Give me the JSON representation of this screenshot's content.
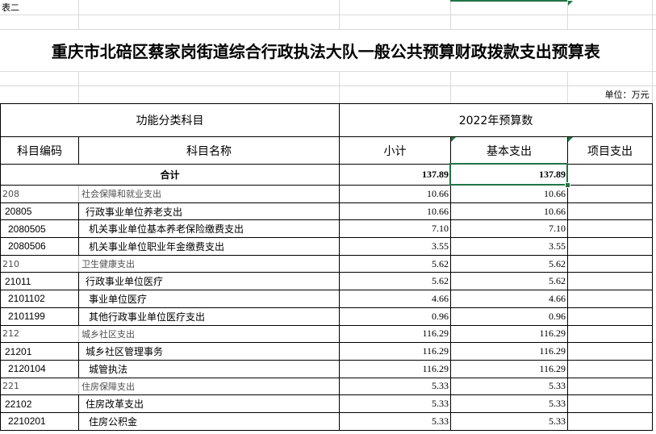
{
  "sheet": {
    "label": "表二",
    "title": "重庆市北碚区蔡家岗街道综合行政执法大队一般公共预算财政拨款支出预算表",
    "unit": "单位：万元"
  },
  "table": {
    "header_groups": {
      "functional_category": "功能分类科目",
      "budget_year": "2022年预算数"
    },
    "columns": {
      "code": "科目编码",
      "name": "科目名称",
      "subtotal": "小计",
      "basic": "基本支出",
      "project": "项目支出"
    },
    "total": {
      "label": "合计",
      "subtotal": "137.89",
      "basic": "137.89",
      "project": ""
    },
    "rows": [
      {
        "code": "208",
        "name": "社会保障和就业支出",
        "subtotal": "10.66",
        "basic": "10.66",
        "project": ""
      },
      {
        "code": "20805",
        "name": "行政事业单位养老支出",
        "subtotal": "10.66",
        "basic": "10.66",
        "project": ""
      },
      {
        "code": "2080505",
        "name": "机关事业单位基本养老保险缴费支出",
        "subtotal": "7.10",
        "basic": "7.10",
        "project": ""
      },
      {
        "code": "2080506",
        "name": "机关事业单位职业年金缴费支出",
        "subtotal": "3.55",
        "basic": "3.55",
        "project": ""
      },
      {
        "code": "210",
        "name": "卫生健康支出",
        "subtotal": "5.62",
        "basic": "5.62",
        "project": ""
      },
      {
        "code": "21011",
        "name": "行政事业单位医疗",
        "subtotal": "5.62",
        "basic": "5.62",
        "project": ""
      },
      {
        "code": "2101102",
        "name": "事业单位医疗",
        "subtotal": "4.66",
        "basic": "4.66",
        "project": ""
      },
      {
        "code": "2101199",
        "name": "其他行政事业单位医疗支出",
        "subtotal": "0.96",
        "basic": "0.96",
        "project": ""
      },
      {
        "code": "212",
        "name": "城乡社区支出",
        "subtotal": "116.29",
        "basic": "116.29",
        "project": ""
      },
      {
        "code": "21201",
        "name": "城乡社区管理事务",
        "subtotal": "116.29",
        "basic": "116.29",
        "project": ""
      },
      {
        "code": "2120104",
        "name": "城管执法",
        "subtotal": "116.29",
        "basic": "116.29",
        "project": ""
      },
      {
        "code": "221",
        "name": "住房保障支出",
        "subtotal": "5.33",
        "basic": "5.33",
        "project": ""
      },
      {
        "code": "22102",
        "name": "住房改革支出",
        "subtotal": "5.33",
        "basic": "5.33",
        "project": ""
      },
      {
        "code": "2210201",
        "name": "住房公积金",
        "subtotal": "5.33",
        "basic": "5.33",
        "project": ""
      }
    ]
  },
  "colors": {
    "selection": "#217346",
    "category_text": "#505050",
    "gridline": "#d9d9d9",
    "table_border": "#000000"
  }
}
